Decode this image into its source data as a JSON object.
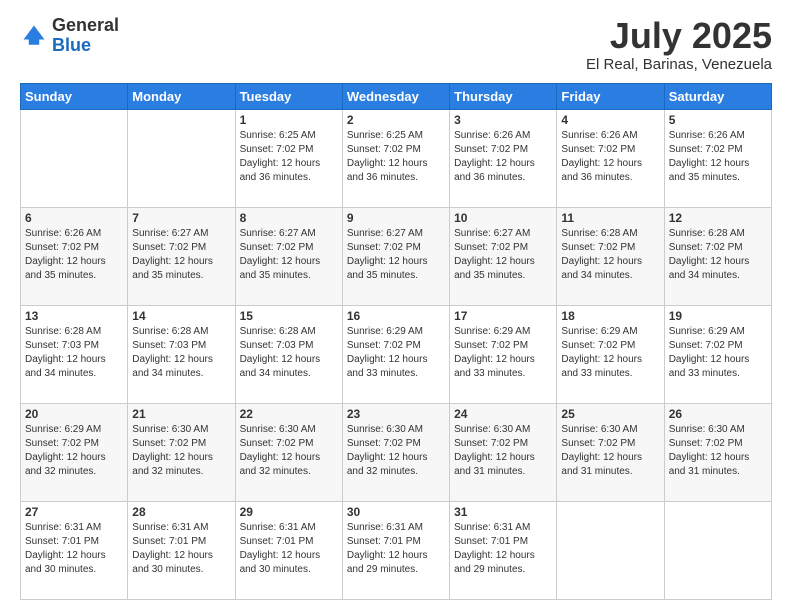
{
  "header": {
    "logo_general": "General",
    "logo_blue": "Blue",
    "month_title": "July 2025",
    "location": "El Real, Barinas, Venezuela"
  },
  "days_of_week": [
    "Sunday",
    "Monday",
    "Tuesday",
    "Wednesday",
    "Thursday",
    "Friday",
    "Saturday"
  ],
  "weeks": [
    [
      {
        "num": "",
        "info": ""
      },
      {
        "num": "",
        "info": ""
      },
      {
        "num": "1",
        "info": "Sunrise: 6:25 AM\nSunset: 7:02 PM\nDaylight: 12 hours and 36 minutes."
      },
      {
        "num": "2",
        "info": "Sunrise: 6:25 AM\nSunset: 7:02 PM\nDaylight: 12 hours and 36 minutes."
      },
      {
        "num": "3",
        "info": "Sunrise: 6:26 AM\nSunset: 7:02 PM\nDaylight: 12 hours and 36 minutes."
      },
      {
        "num": "4",
        "info": "Sunrise: 6:26 AM\nSunset: 7:02 PM\nDaylight: 12 hours and 36 minutes."
      },
      {
        "num": "5",
        "info": "Sunrise: 6:26 AM\nSunset: 7:02 PM\nDaylight: 12 hours and 35 minutes."
      }
    ],
    [
      {
        "num": "6",
        "info": "Sunrise: 6:26 AM\nSunset: 7:02 PM\nDaylight: 12 hours and 35 minutes."
      },
      {
        "num": "7",
        "info": "Sunrise: 6:27 AM\nSunset: 7:02 PM\nDaylight: 12 hours and 35 minutes."
      },
      {
        "num": "8",
        "info": "Sunrise: 6:27 AM\nSunset: 7:02 PM\nDaylight: 12 hours and 35 minutes."
      },
      {
        "num": "9",
        "info": "Sunrise: 6:27 AM\nSunset: 7:02 PM\nDaylight: 12 hours and 35 minutes."
      },
      {
        "num": "10",
        "info": "Sunrise: 6:27 AM\nSunset: 7:02 PM\nDaylight: 12 hours and 35 minutes."
      },
      {
        "num": "11",
        "info": "Sunrise: 6:28 AM\nSunset: 7:02 PM\nDaylight: 12 hours and 34 minutes."
      },
      {
        "num": "12",
        "info": "Sunrise: 6:28 AM\nSunset: 7:02 PM\nDaylight: 12 hours and 34 minutes."
      }
    ],
    [
      {
        "num": "13",
        "info": "Sunrise: 6:28 AM\nSunset: 7:03 PM\nDaylight: 12 hours and 34 minutes."
      },
      {
        "num": "14",
        "info": "Sunrise: 6:28 AM\nSunset: 7:03 PM\nDaylight: 12 hours and 34 minutes."
      },
      {
        "num": "15",
        "info": "Sunrise: 6:28 AM\nSunset: 7:03 PM\nDaylight: 12 hours and 34 minutes."
      },
      {
        "num": "16",
        "info": "Sunrise: 6:29 AM\nSunset: 7:02 PM\nDaylight: 12 hours and 33 minutes."
      },
      {
        "num": "17",
        "info": "Sunrise: 6:29 AM\nSunset: 7:02 PM\nDaylight: 12 hours and 33 minutes."
      },
      {
        "num": "18",
        "info": "Sunrise: 6:29 AM\nSunset: 7:02 PM\nDaylight: 12 hours and 33 minutes."
      },
      {
        "num": "19",
        "info": "Sunrise: 6:29 AM\nSunset: 7:02 PM\nDaylight: 12 hours and 33 minutes."
      }
    ],
    [
      {
        "num": "20",
        "info": "Sunrise: 6:29 AM\nSunset: 7:02 PM\nDaylight: 12 hours and 32 minutes."
      },
      {
        "num": "21",
        "info": "Sunrise: 6:30 AM\nSunset: 7:02 PM\nDaylight: 12 hours and 32 minutes."
      },
      {
        "num": "22",
        "info": "Sunrise: 6:30 AM\nSunset: 7:02 PM\nDaylight: 12 hours and 32 minutes."
      },
      {
        "num": "23",
        "info": "Sunrise: 6:30 AM\nSunset: 7:02 PM\nDaylight: 12 hours and 32 minutes."
      },
      {
        "num": "24",
        "info": "Sunrise: 6:30 AM\nSunset: 7:02 PM\nDaylight: 12 hours and 31 minutes."
      },
      {
        "num": "25",
        "info": "Sunrise: 6:30 AM\nSunset: 7:02 PM\nDaylight: 12 hours and 31 minutes."
      },
      {
        "num": "26",
        "info": "Sunrise: 6:30 AM\nSunset: 7:02 PM\nDaylight: 12 hours and 31 minutes."
      }
    ],
    [
      {
        "num": "27",
        "info": "Sunrise: 6:31 AM\nSunset: 7:01 PM\nDaylight: 12 hours and 30 minutes."
      },
      {
        "num": "28",
        "info": "Sunrise: 6:31 AM\nSunset: 7:01 PM\nDaylight: 12 hours and 30 minutes."
      },
      {
        "num": "29",
        "info": "Sunrise: 6:31 AM\nSunset: 7:01 PM\nDaylight: 12 hours and 30 minutes."
      },
      {
        "num": "30",
        "info": "Sunrise: 6:31 AM\nSunset: 7:01 PM\nDaylight: 12 hours and 29 minutes."
      },
      {
        "num": "31",
        "info": "Sunrise: 6:31 AM\nSunset: 7:01 PM\nDaylight: 12 hours and 29 minutes."
      },
      {
        "num": "",
        "info": ""
      },
      {
        "num": "",
        "info": ""
      }
    ]
  ]
}
